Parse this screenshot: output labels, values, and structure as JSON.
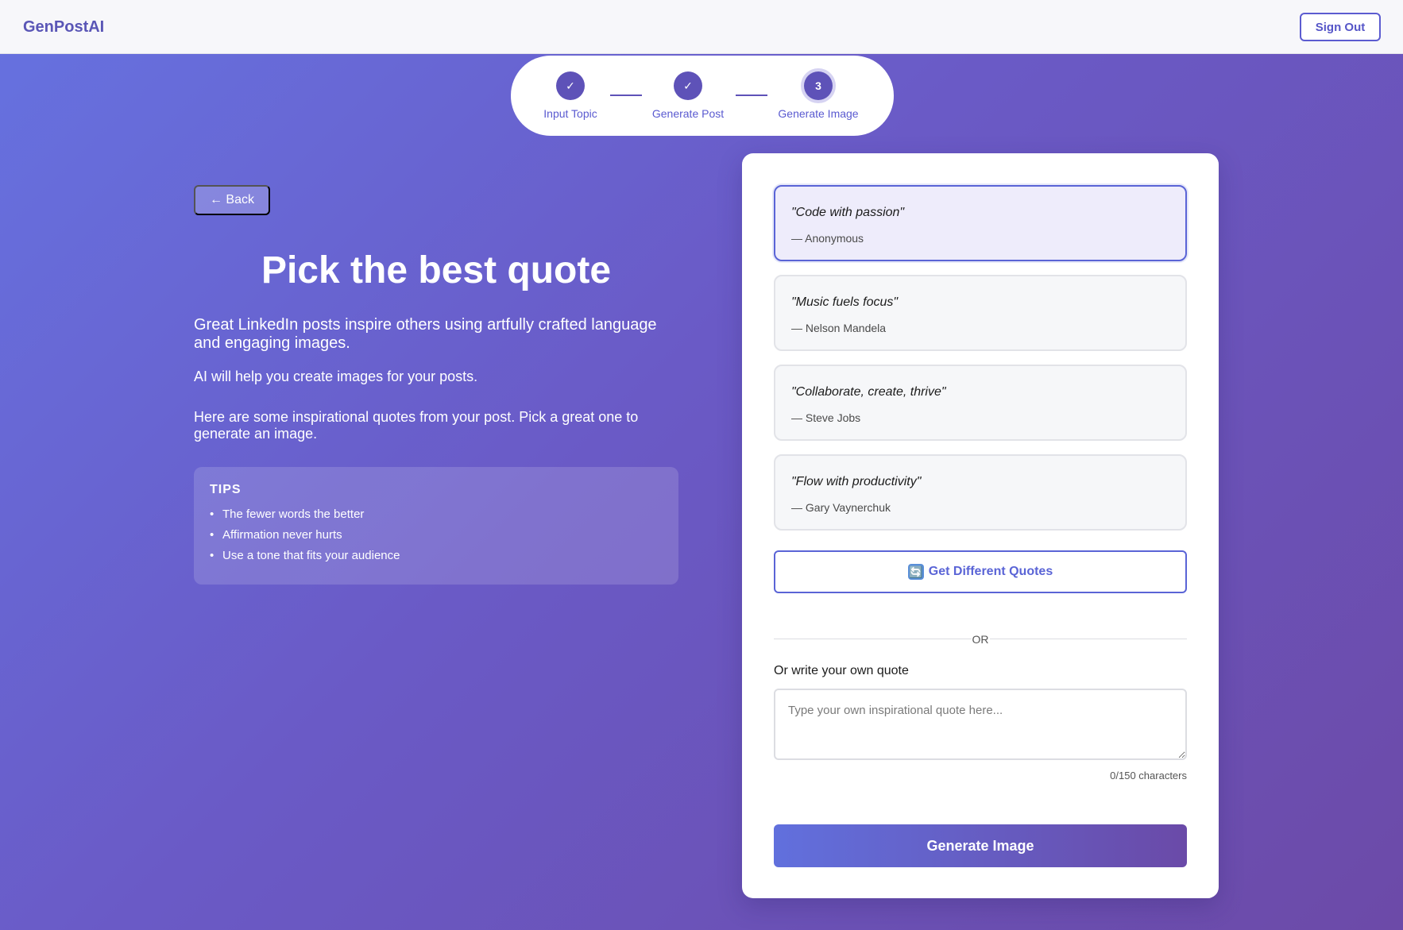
{
  "header": {
    "logo": "GenPostAI",
    "sign_out_label": "Sign Out"
  },
  "stepper": {
    "steps": [
      {
        "label": "Input Topic",
        "marker": "✓",
        "state": "completed"
      },
      {
        "label": "Generate Post",
        "marker": "✓",
        "state": "completed"
      },
      {
        "label": "Generate Image",
        "marker": "3",
        "state": "active"
      }
    ]
  },
  "left": {
    "back_label": "← Back",
    "title": "Pick the best quote",
    "description_1": "Great LinkedIn posts inspire others using artfully crafted language and engaging images.",
    "description_2": "AI will help you create images for your posts.",
    "description_3": "Here are some inspirational quotes from your post. Pick a great one to generate an image.",
    "tips": {
      "title": "TIPS",
      "items": [
        "The fewer words the better",
        "Affirmation never hurts",
        "Use a tone that fits your audience"
      ]
    }
  },
  "card": {
    "quotes": [
      {
        "text": "\"Code with passion\"",
        "author": "— Anonymous",
        "selected": true
      },
      {
        "text": "\"Music fuels focus\"",
        "author": "— Nelson Mandela",
        "selected": false
      },
      {
        "text": "\"Collaborate, create, thrive\"",
        "author": "— Steve Jobs",
        "selected": false
      },
      {
        "text": "\"Flow with productivity\"",
        "author": "— Gary Vaynerchuk",
        "selected": false
      }
    ],
    "refresh_icon": "🔄",
    "different_quotes_label": "Get Different Quotes",
    "or_text": "OR",
    "own_quote_label": "Or write your own quote",
    "own_quote_placeholder": "Type your own inspirational quote here...",
    "own_quote_value": "",
    "char_count": "0/150 characters",
    "generate_label": "Generate Image"
  },
  "colors": {
    "accent": "#5a64d6",
    "step_fill": "#5e52b8",
    "gradient_start": "#6672e0",
    "gradient_end": "#6c4aa8"
  }
}
